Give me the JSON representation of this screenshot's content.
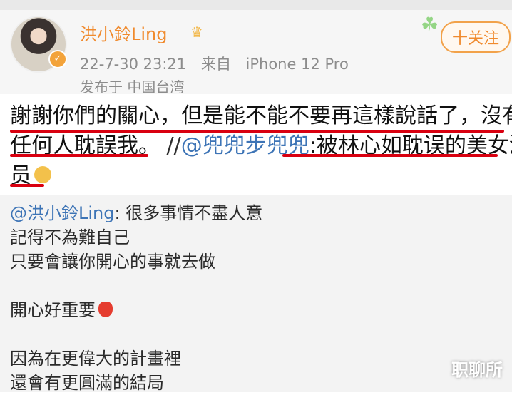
{
  "post": {
    "username": "洪小鈴Ling",
    "timestamp": "22-7-30 23:21",
    "source_prefix": "来自",
    "source_device": "iPhone 12 Pro",
    "location": "发布于 中国台湾",
    "follow_label": "十关注"
  },
  "content": {
    "line1": "謝謝你們的關心，但是能不能不要再這樣說話了，沒有",
    "line2_main": "任何人耽誤我。",
    "line2_sep": " //",
    "line2_mention": "@兜兜步兜兜",
    "line2_rest": ":被林心如耽误的美女演",
    "line3": "员"
  },
  "quote": {
    "mention": "@洪小鈴Ling",
    "line1_rest": ": 很多事情不盡人意",
    "line2": "記得不為難自己",
    "line3": "只要會讓你開心的事就去做",
    "line4": "開心好重要",
    "line5": "因為在更偉大的計畫裡",
    "line6": "還會有更圓滿的結局"
  },
  "watermark": "职聊所",
  "colors": {
    "username": "#f08a2d",
    "mention": "#3d74b6",
    "underline": "#d90010",
    "follow_border": "#f2a24a"
  },
  "icons": {
    "crown": "crown-icon",
    "verified": "verified-badge-icon",
    "follow": "plus-icon",
    "emoji": "tongue-face-emoji",
    "strawberry": "strawberry-emoji",
    "clover": "clover-decoration-icon"
  }
}
